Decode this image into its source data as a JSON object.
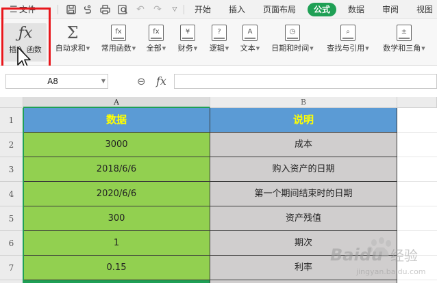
{
  "menubar": {
    "file_label": "文件",
    "tabs": [
      "开始",
      "插入",
      "页面布局",
      "公式",
      "数据",
      "审阅",
      "视图"
    ],
    "active_tab": "公式"
  },
  "ribbon": {
    "insert_function": "插入 函数",
    "autosum": "自动求和",
    "common_functions": "常用函数",
    "all": "全部",
    "finance": "财务",
    "logic": "逻辑",
    "text": "文本",
    "datetime": "日期和时间",
    "lookup": "查找与引用",
    "math": "数学和三角"
  },
  "formula_bar": {
    "cell_ref": "A8",
    "fx_symbol": "fx",
    "formula_value": ""
  },
  "sheet": {
    "columns": [
      "A",
      "B"
    ],
    "rows": [
      {
        "num": "1",
        "a": "数据",
        "b": "说明"
      },
      {
        "num": "2",
        "a": "3000",
        "b": "成本"
      },
      {
        "num": "3",
        "a": "2018/6/6",
        "b": "购入资产的日期"
      },
      {
        "num": "4",
        "a": "2020/6/6",
        "b": "第一个期间结束时的日期"
      },
      {
        "num": "5",
        "a": "300",
        "b": "资产残值"
      },
      {
        "num": "6",
        "a": "1",
        "b": "期次"
      },
      {
        "num": "7",
        "a": "0.15",
        "b": "利率"
      }
    ]
  },
  "watermark": {
    "brand": "Baidu",
    "sub": "经验",
    "url": "jingyan.baidu.com"
  },
  "colors": {
    "accent": "#1fa055",
    "header_fill": "#5b9bd5",
    "header_text": "#ffff00",
    "col_a_fill": "#92d050",
    "col_b_fill": "#d0cece",
    "highlight": "#e8161b"
  },
  "icons": [
    "menu-icon",
    "save-icon",
    "clipboard-icon",
    "print-icon",
    "preview-icon",
    "undo-icon",
    "redo-icon",
    "more-icon",
    "fx-icon",
    "sigma-icon",
    "zoom-icon"
  ]
}
